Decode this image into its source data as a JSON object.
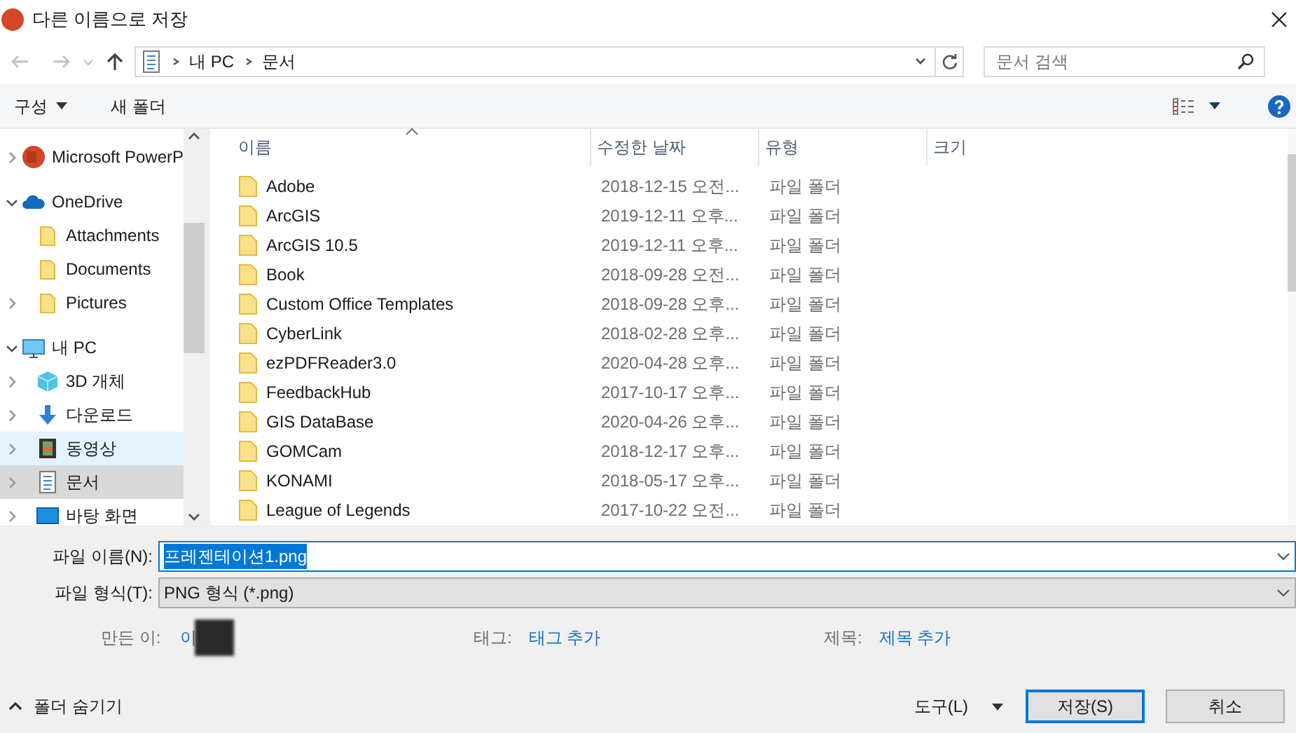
{
  "window": {
    "title": "다른 이름으로 저장"
  },
  "address": {
    "crumbs": [
      "내 PC",
      "문서"
    ]
  },
  "search": {
    "placeholder": "문서 검색"
  },
  "toolbar": {
    "organize": "구성",
    "new_folder": "새 폴더"
  },
  "sidebar": {
    "items": [
      {
        "label": "Microsoft PowerP",
        "kind": "app",
        "expanded": false,
        "selected": false,
        "hovered": false
      },
      {
        "label": "OneDrive",
        "kind": "cloud",
        "expanded": true,
        "selected": false,
        "hovered": false,
        "children": [
          {
            "label": "Attachments",
            "kind": "folder",
            "selected": false,
            "hovered": false
          },
          {
            "label": "Documents",
            "kind": "folder",
            "selected": false,
            "hovered": false
          },
          {
            "label": "Pictures",
            "kind": "folder",
            "expanded": false,
            "selected": false,
            "hovered": false
          }
        ]
      },
      {
        "label": "내 PC",
        "kind": "pc",
        "expanded": true,
        "selected": false,
        "hovered": false,
        "children": [
          {
            "label": "3D 개체",
            "kind": "cube",
            "expanded": false,
            "selected": false,
            "hovered": false
          },
          {
            "label": "다운로드",
            "kind": "download",
            "expanded": false,
            "selected": false,
            "hovered": false
          },
          {
            "label": "동영상",
            "kind": "video",
            "expanded": false,
            "selected": false,
            "hovered": true
          },
          {
            "label": "문서",
            "kind": "document",
            "expanded": false,
            "selected": true,
            "hovered": false
          },
          {
            "label": "바탕 화면",
            "kind": "desktop",
            "expanded": false,
            "selected": false,
            "hovered": false
          }
        ]
      }
    ]
  },
  "table": {
    "columns": [
      "이름",
      "수정한 날짜",
      "유형",
      "크기"
    ],
    "rows": [
      [
        "Adobe",
        "2018-12-15 오전...",
        "파일 폴더"
      ],
      [
        "ArcGIS",
        "2019-12-11 오후...",
        "파일 폴더"
      ],
      [
        "ArcGIS 10.5",
        "2019-12-11 오후...",
        "파일 폴더"
      ],
      [
        "Book",
        "2018-09-28 오전...",
        "파일 폴더"
      ],
      [
        "Custom Office Templates",
        "2018-09-28 오후...",
        "파일 폴더"
      ],
      [
        "CyberLink",
        "2018-02-28 오후...",
        "파일 폴더"
      ],
      [
        "ezPDFReader3.0",
        "2020-04-28 오후...",
        "파일 폴더"
      ],
      [
        "FeedbackHub",
        "2017-10-17 오후...",
        "파일 폴더"
      ],
      [
        "GIS DataBase",
        "2020-04-26 오후...",
        "파일 폴더"
      ],
      [
        "GOMCam",
        "2018-12-17 오후...",
        "파일 폴더"
      ],
      [
        "KONAMI",
        "2018-05-17 오후...",
        "파일 폴더"
      ],
      [
        "League of Legends",
        "2017-10-22 오전...",
        "파일 폴더"
      ]
    ]
  },
  "file_name": {
    "label": "파일 이름(N):",
    "value": "프레젠테이션1.png",
    "text_selected": true
  },
  "file_type": {
    "label": "파일 형식(T):",
    "value": "PNG 형식 (*.png)"
  },
  "meta": [
    {
      "label": "만든 이:",
      "value": "이"
    },
    {
      "label": "태그:",
      "value": "태그 추가"
    },
    {
      "label": "제목:",
      "value": "제목 추가"
    }
  ],
  "footer": {
    "hide_folders": "폴더 숨기기",
    "tools": "도구(L)",
    "save": "저장(S)",
    "cancel": "취소"
  }
}
